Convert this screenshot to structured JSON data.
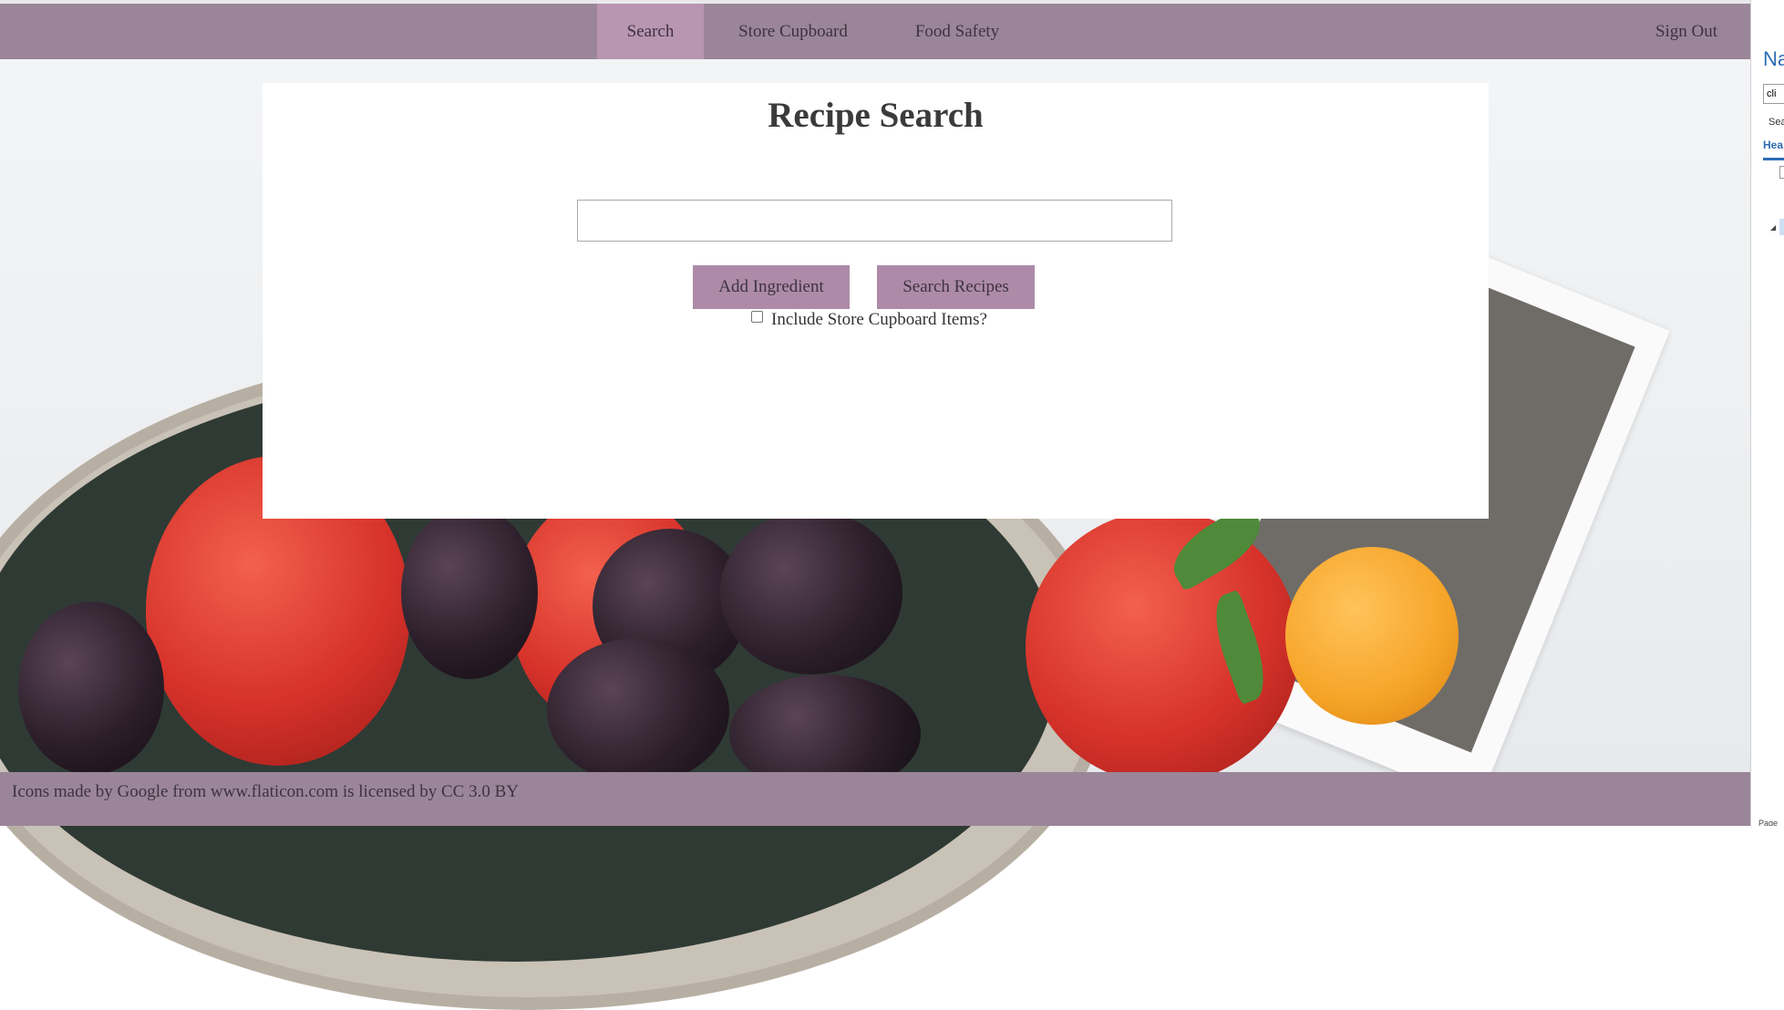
{
  "nav": {
    "items": [
      {
        "label": "Search",
        "active": true
      },
      {
        "label": "Store Cupboard",
        "active": false
      },
      {
        "label": "Food Safety",
        "active": false
      }
    ],
    "sign_out": "Sign Out"
  },
  "main": {
    "title": "Recipe Search",
    "ingredient_input": {
      "value": "",
      "placeholder": ""
    },
    "add_ingredient_label": "Add Ingredient",
    "search_recipes_label": "Search Recipes",
    "include_store_cupboard_label": "Include Store Cupboard Items?",
    "include_store_cupboard_checked": false
  },
  "footer": {
    "attribution": "Icons made by Google from www.flaticon.com is licensed by CC 3.0 BY"
  },
  "side_pane": {
    "title": "Na",
    "search_value": "cli",
    "label": "Sea",
    "tab": "Hea",
    "bottom": "Page"
  },
  "colors": {
    "nav_bg": "#9b8599",
    "nav_active": "#b895b1",
    "button_bg": "#ad8ba8",
    "text": "#3e3340"
  }
}
